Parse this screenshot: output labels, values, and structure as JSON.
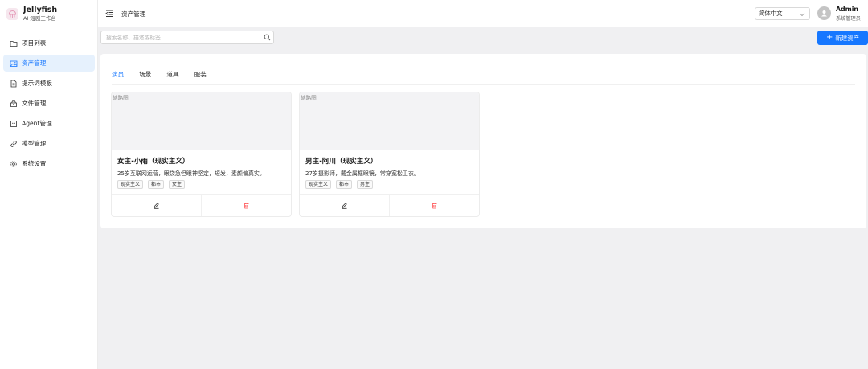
{
  "brand": {
    "name": "Jellyfish",
    "subtitle": "AI 短剧工作台",
    "icon": "jellyfish-logo-icon"
  },
  "sidebar": {
    "items": [
      {
        "label": "项目列表",
        "icon": "folder-icon",
        "active": false
      },
      {
        "label": "资产管理",
        "icon": "image-icon",
        "active": true
      },
      {
        "label": "提示词模板",
        "icon": "file-text-icon",
        "active": false
      },
      {
        "label": "文件管理",
        "icon": "archive-icon",
        "active": false
      },
      {
        "label": "Agent管理",
        "icon": "robot-icon",
        "active": false
      },
      {
        "label": "模型管理",
        "icon": "link-icon",
        "active": false
      },
      {
        "label": "系统设置",
        "icon": "gear-icon",
        "active": false
      }
    ]
  },
  "header": {
    "title": "资产管理",
    "language": "简体中文",
    "user": {
      "name": "Admin",
      "role": "系统管理员"
    }
  },
  "search": {
    "placeholder": "搜索名称、描述或标签",
    "value": ""
  },
  "actions": {
    "new_asset": "新建资产"
  },
  "tabs": [
    {
      "label": "演员",
      "active": true
    },
    {
      "label": "场景",
      "active": false
    },
    {
      "label": "道具",
      "active": false
    },
    {
      "label": "服装",
      "active": false
    }
  ],
  "cards": [
    {
      "thumbnail_label": "缩略图",
      "title": "女主-小雨（现实主义）",
      "description": "25岁互联网运营，眼袋急但眼神坚定，短发，素颜偏真实。",
      "tags": [
        "现实主义",
        "都市",
        "女主"
      ]
    },
    {
      "thumbnail_label": "缩略图",
      "title": "男主-阿川（现实主义）",
      "description": "27岁摄影师，戴金属框眼镜，常穿宽松卫衣。",
      "tags": [
        "现实主义",
        "都市",
        "男主"
      ]
    }
  ],
  "colors": {
    "primary": "#1677ff",
    "danger": "#ff4d4f",
    "active_bg": "#e6f1fd"
  }
}
